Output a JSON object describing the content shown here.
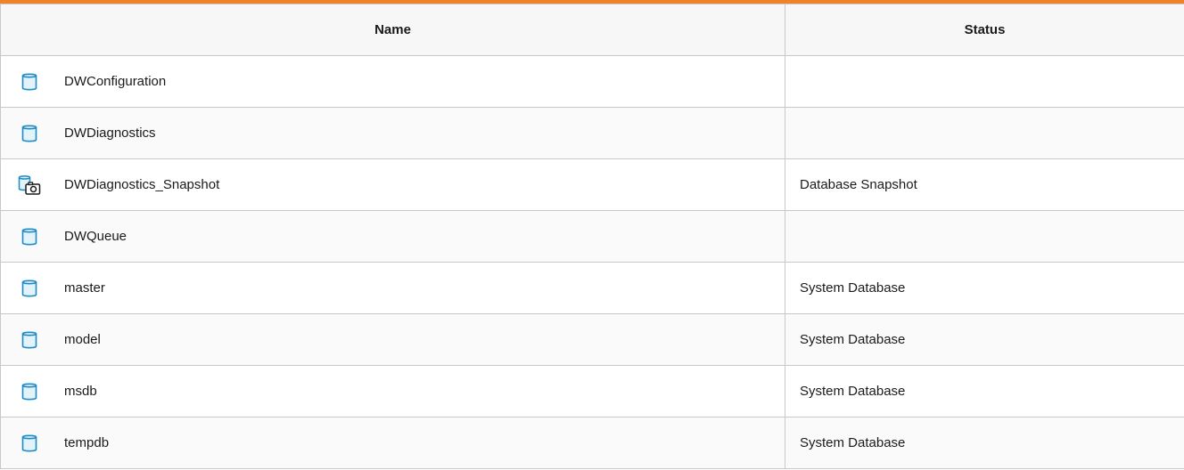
{
  "table": {
    "columns": {
      "name": "Name",
      "status": "Status"
    },
    "rows": [
      {
        "name": "DWConfiguration",
        "status": "",
        "icon": "database-icon"
      },
      {
        "name": "DWDiagnostics",
        "status": "",
        "icon": "database-icon"
      },
      {
        "name": "DWDiagnostics_Snapshot",
        "status": "Database Snapshot",
        "icon": "database-snapshot-icon"
      },
      {
        "name": "DWQueue",
        "status": "",
        "icon": "database-icon"
      },
      {
        "name": "master",
        "status": "System Database",
        "icon": "database-icon"
      },
      {
        "name": "model",
        "status": "System Database",
        "icon": "database-icon"
      },
      {
        "name": "msdb",
        "status": "System Database",
        "icon": "database-icon"
      },
      {
        "name": "tempdb",
        "status": "System Database",
        "icon": "database-icon"
      }
    ]
  },
  "colors": {
    "accent": "#f0832a",
    "icon_stroke": "#1e8bc3",
    "icon_fill": "#e3f3fb",
    "border": "#c8c8c8"
  }
}
